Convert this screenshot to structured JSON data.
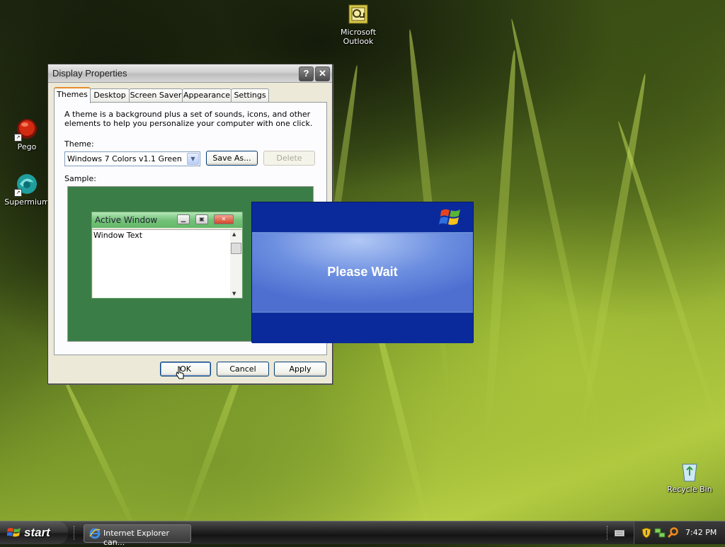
{
  "desktop": {
    "icons": [
      {
        "label": "Microsoft Outlook",
        "line1": "Microsoft",
        "line2": "Outlook"
      },
      {
        "label": "Pego"
      },
      {
        "label": "Supermium"
      },
      {
        "label": "Recycle Bin"
      }
    ]
  },
  "dialog": {
    "title": "Display Properties",
    "help_glyph": "?",
    "close_glyph": "✕",
    "tabs": [
      "Themes",
      "Desktop",
      "Screen Saver",
      "Appearance",
      "Settings"
    ],
    "active_tab": "Themes",
    "description": "A theme is a background plus a set of sounds, icons, and other elements to help you personalize your computer with one click.",
    "theme_label": "Theme:",
    "theme_value": "Windows 7 Colors v1.1 Green",
    "save_as_label": "Save As...",
    "delete_label": "Delete",
    "sample_label": "Sample:",
    "preview": {
      "window_title": "Active Window",
      "window_text": "Window Text"
    },
    "ok_label": "OK",
    "cancel_label": "Cancel",
    "apply_label": "Apply"
  },
  "please_wait": {
    "message": "Please Wait"
  },
  "taskbar": {
    "start_label": "start",
    "task_label": "Internet Explorer can...",
    "clock": "7:42 PM"
  },
  "colors": {
    "sample_bg": "#3b7d46",
    "wait_bg": "#0831a5",
    "tab_highlight": "#e68b2c"
  }
}
